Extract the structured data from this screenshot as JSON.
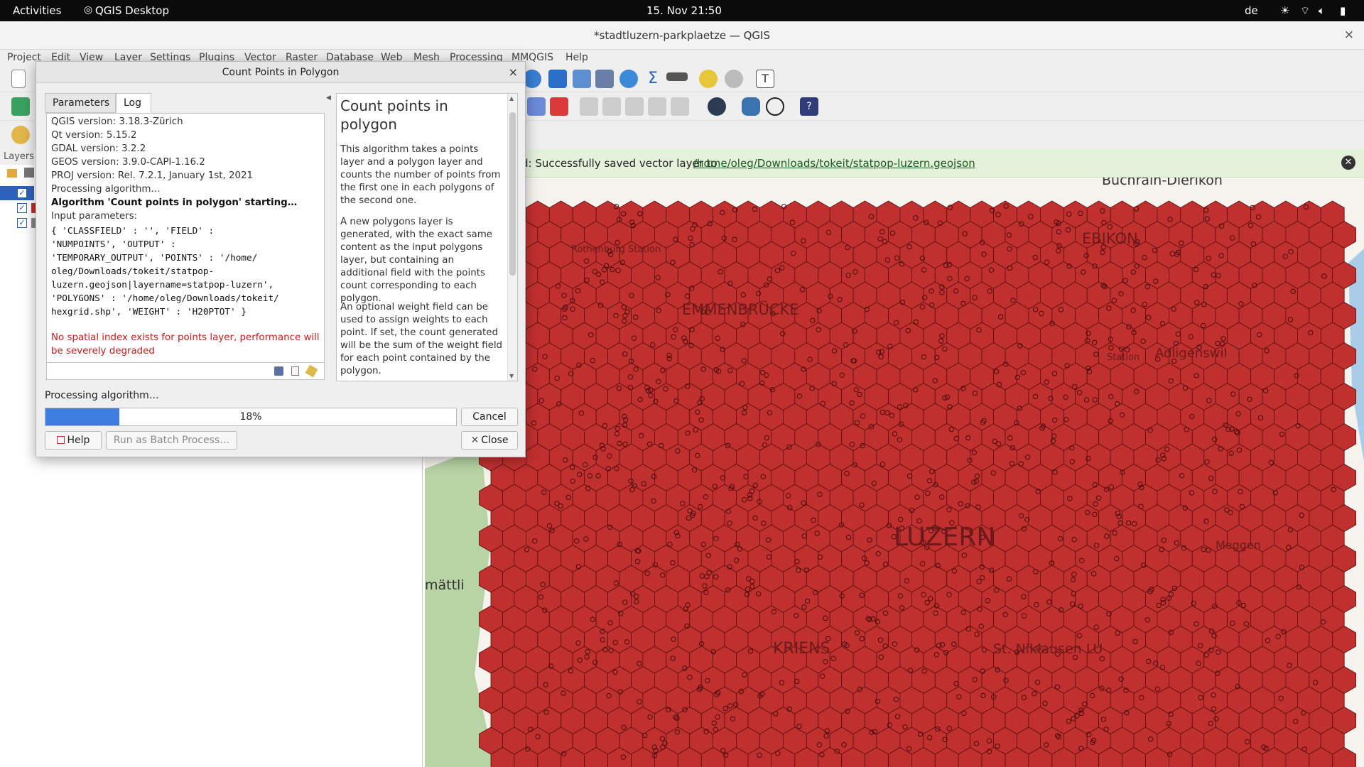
{
  "topbar": {
    "activities": "Activities",
    "app_name": "QGIS Desktop",
    "clock": "15. Nov  21:50",
    "lang": "de"
  },
  "window": {
    "title": "*stadtluzern-parkplaetze — QGIS",
    "close": "×"
  },
  "menu": [
    "Project",
    "Edit",
    "View",
    "Layer",
    "Settings",
    "Plugins",
    "Vector",
    "Raster",
    "Database",
    "Web",
    "Mesh",
    "Processing",
    "MMQGIS",
    "Help"
  ],
  "layers_panel": {
    "header": "Layers"
  },
  "message_bar": {
    "text": "d: Successfully saved vector layer to",
    "link": "/home/oleg/Downloads/tokeit/statpop-luzern.geojson",
    "close": "✕"
  },
  "map_labels": [
    "Buchrain-Dierikon",
    "EBIKON",
    "Rothenburg Station",
    "EMMENBRÜCKE",
    "Adligenswil",
    "Station",
    "LUZERN",
    "KRIENS",
    "St. Niklausen LU",
    "mättli",
    "Meggen"
  ],
  "dialog": {
    "title": "Count Points in Polygon",
    "close": "×",
    "tabs": [
      "Parameters",
      "Log"
    ],
    "active_tab": "Log",
    "log": {
      "qgis_version": "QGIS version: 3.18.3-Zürich",
      "qt_version": "Qt version: 5.15.2",
      "gdal_version": "GDAL version: 3.2.2",
      "geos_version": "GEOS version: 3.9.0-CAPI-1.16.2",
      "proj_version": "PROJ version: Rel. 7.2.1, January 1st, 2021",
      "processing": "Processing algorithm…",
      "starting": "Algorithm 'Count points in polygon' starting…",
      "input_params": "Input parameters:",
      "params_lines": [
        "{ 'CLASSFIELD' : '', 'FIELD' :",
        "'NUMPOINTS', 'OUTPUT' :",
        "'TEMPORARY_OUTPUT', 'POINTS' : '/home/",
        "oleg/Downloads/tokeit/statpop-",
        "luzern.geojson|layername=statpop-luzern',",
        "'POLYGONS' : '/home/oleg/Downloads/tokeit/",
        "hexgrid.shp', 'WEIGHT' : 'H20PTOT' }"
      ],
      "warning_lines": [
        "No spatial index exists for points layer, performance will",
        "be severely degraded"
      ]
    },
    "help": {
      "heading": "Count points in polygon",
      "p1": "This algorithm takes a points layer and a polygon layer and counts the number of points from the first one in each polygons of the second one.",
      "p2": "A new polygons layer is generated, with the exact same content as the input polygons layer, but containing an additional field with the points count corresponding to each polygon.",
      "p3": "An optional weight field can be used to assign weights to each point. If set, the count generated will be the sum of the weight field for each point contained by the polygon."
    },
    "status": "Processing algorithm…",
    "progress_percent": 18,
    "progress_label": "18%",
    "buttons": {
      "cancel": "Cancel",
      "help": "Help",
      "batch": "Run as Batch Process…",
      "close": "Close"
    }
  },
  "colors": {
    "hex_fill": "#c0302f",
    "hex_stroke": "#5a1010",
    "accent": "#3d7de0",
    "success_bg": "#e4f2dc"
  }
}
